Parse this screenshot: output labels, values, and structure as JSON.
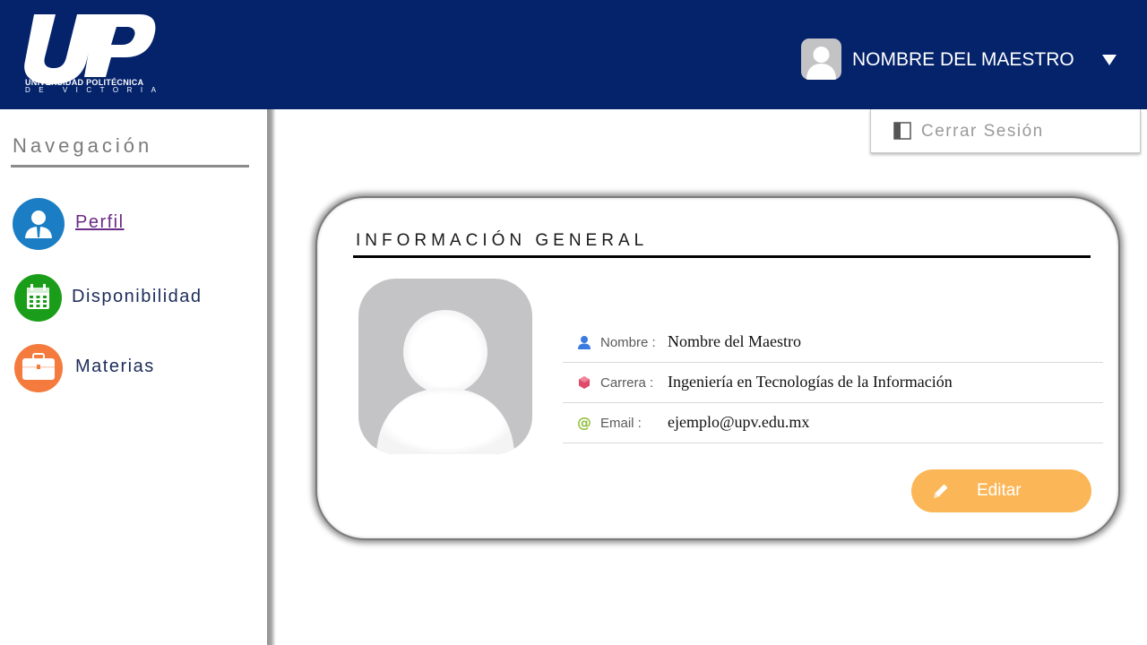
{
  "header": {
    "logo_text": "UP",
    "logo_line1": "UNIVERSIDAD  POLITÉCNICA",
    "logo_line2": "DE VICTORIA",
    "user_name": "NOMBRE DEL MAESTRO",
    "bg_color": "#04236b"
  },
  "user_menu": {
    "logout_label": "Cerrar Sesión",
    "logout_icon": "logout-icon"
  },
  "sidebar": {
    "title": "Navegación",
    "items": [
      {
        "label": "Perfil",
        "icon": "user-icon",
        "color": "#1b7ec4",
        "active": true
      },
      {
        "label": "Disponibilidad",
        "icon": "calendar-icon",
        "color": "#1a9e1a"
      },
      {
        "label": "Materias",
        "icon": "briefcase-icon",
        "color": "#f47a3e"
      }
    ]
  },
  "profile_card": {
    "title": "INFORMACIÓN GENERAL",
    "fields": [
      {
        "label": "Nombre :",
        "value": "Nombre del Maestro",
        "icon": "person-icon",
        "icon_color": "#3b7be0"
      },
      {
        "label": "Carrera :",
        "value": "Ingeniería en Tecnologías de la Información",
        "icon": "cube-icon",
        "icon_color": "#e04a6a"
      },
      {
        "label": "Email :",
        "value": "ejemplo@upv.edu.mx",
        "icon": "at-icon",
        "icon_color": "#8fbf3a"
      }
    ],
    "edit_label": "Editar",
    "edit_color": "#fbb757"
  }
}
